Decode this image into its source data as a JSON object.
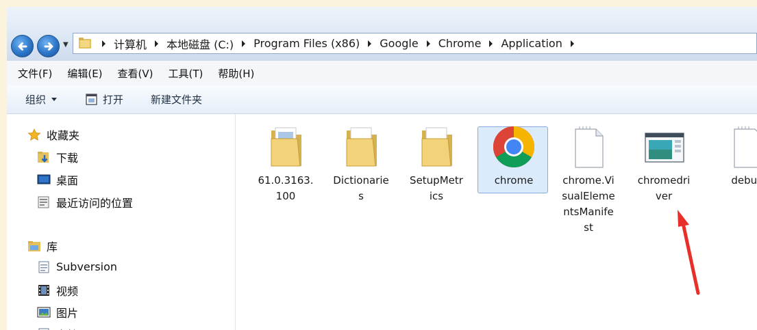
{
  "address_bar": {
    "breadcrumbs": [
      "计算机",
      "本地磁盘 (C:)",
      "Program Files (x86)",
      "Google",
      "Chrome",
      "Application"
    ]
  },
  "menu": [
    "文件(F)",
    "编辑(E)",
    "查看(V)",
    "工具(T)",
    "帮助(H)"
  ],
  "toolbar": {
    "organize": "组织",
    "open": "打开",
    "new_folder": "新建文件夹"
  },
  "sidebar": {
    "favorites": {
      "label": "收藏夹",
      "items": [
        "下载",
        "桌面",
        "最近访问的位置"
      ]
    },
    "libraries": {
      "label": "库",
      "items": [
        "Subversion",
        "视频",
        "图片",
        "文档"
      ]
    }
  },
  "files": [
    {
      "name": "61.0.3163.100",
      "lines": [
        "61.0.3163.",
        "100"
      ],
      "type": "folder"
    },
    {
      "name": "Dictionaries",
      "lines": [
        "Dictionarie",
        "s"
      ],
      "type": "folder"
    },
    {
      "name": "SetupMetrics",
      "lines": [
        "SetupMetr",
        "ics"
      ],
      "type": "folder"
    },
    {
      "name": "chrome",
      "lines": [
        "chrome"
      ],
      "type": "chrome-app",
      "selected": true
    },
    {
      "name": "chrome.VisualElementsManifest",
      "lines": [
        "chrome.Vi",
        "sualEleme",
        "ntsManife",
        "st"
      ],
      "type": "document"
    },
    {
      "name": "chromedriver",
      "lines": [
        "chromedri",
        "ver"
      ],
      "type": "exe"
    },
    {
      "name": "debug",
      "lines": [
        "debug"
      ],
      "type": "document"
    }
  ],
  "colors": {
    "annotation_arrow": "#e8302a",
    "selection": "#dcebfc",
    "chrome_blue": "#4285f4"
  }
}
